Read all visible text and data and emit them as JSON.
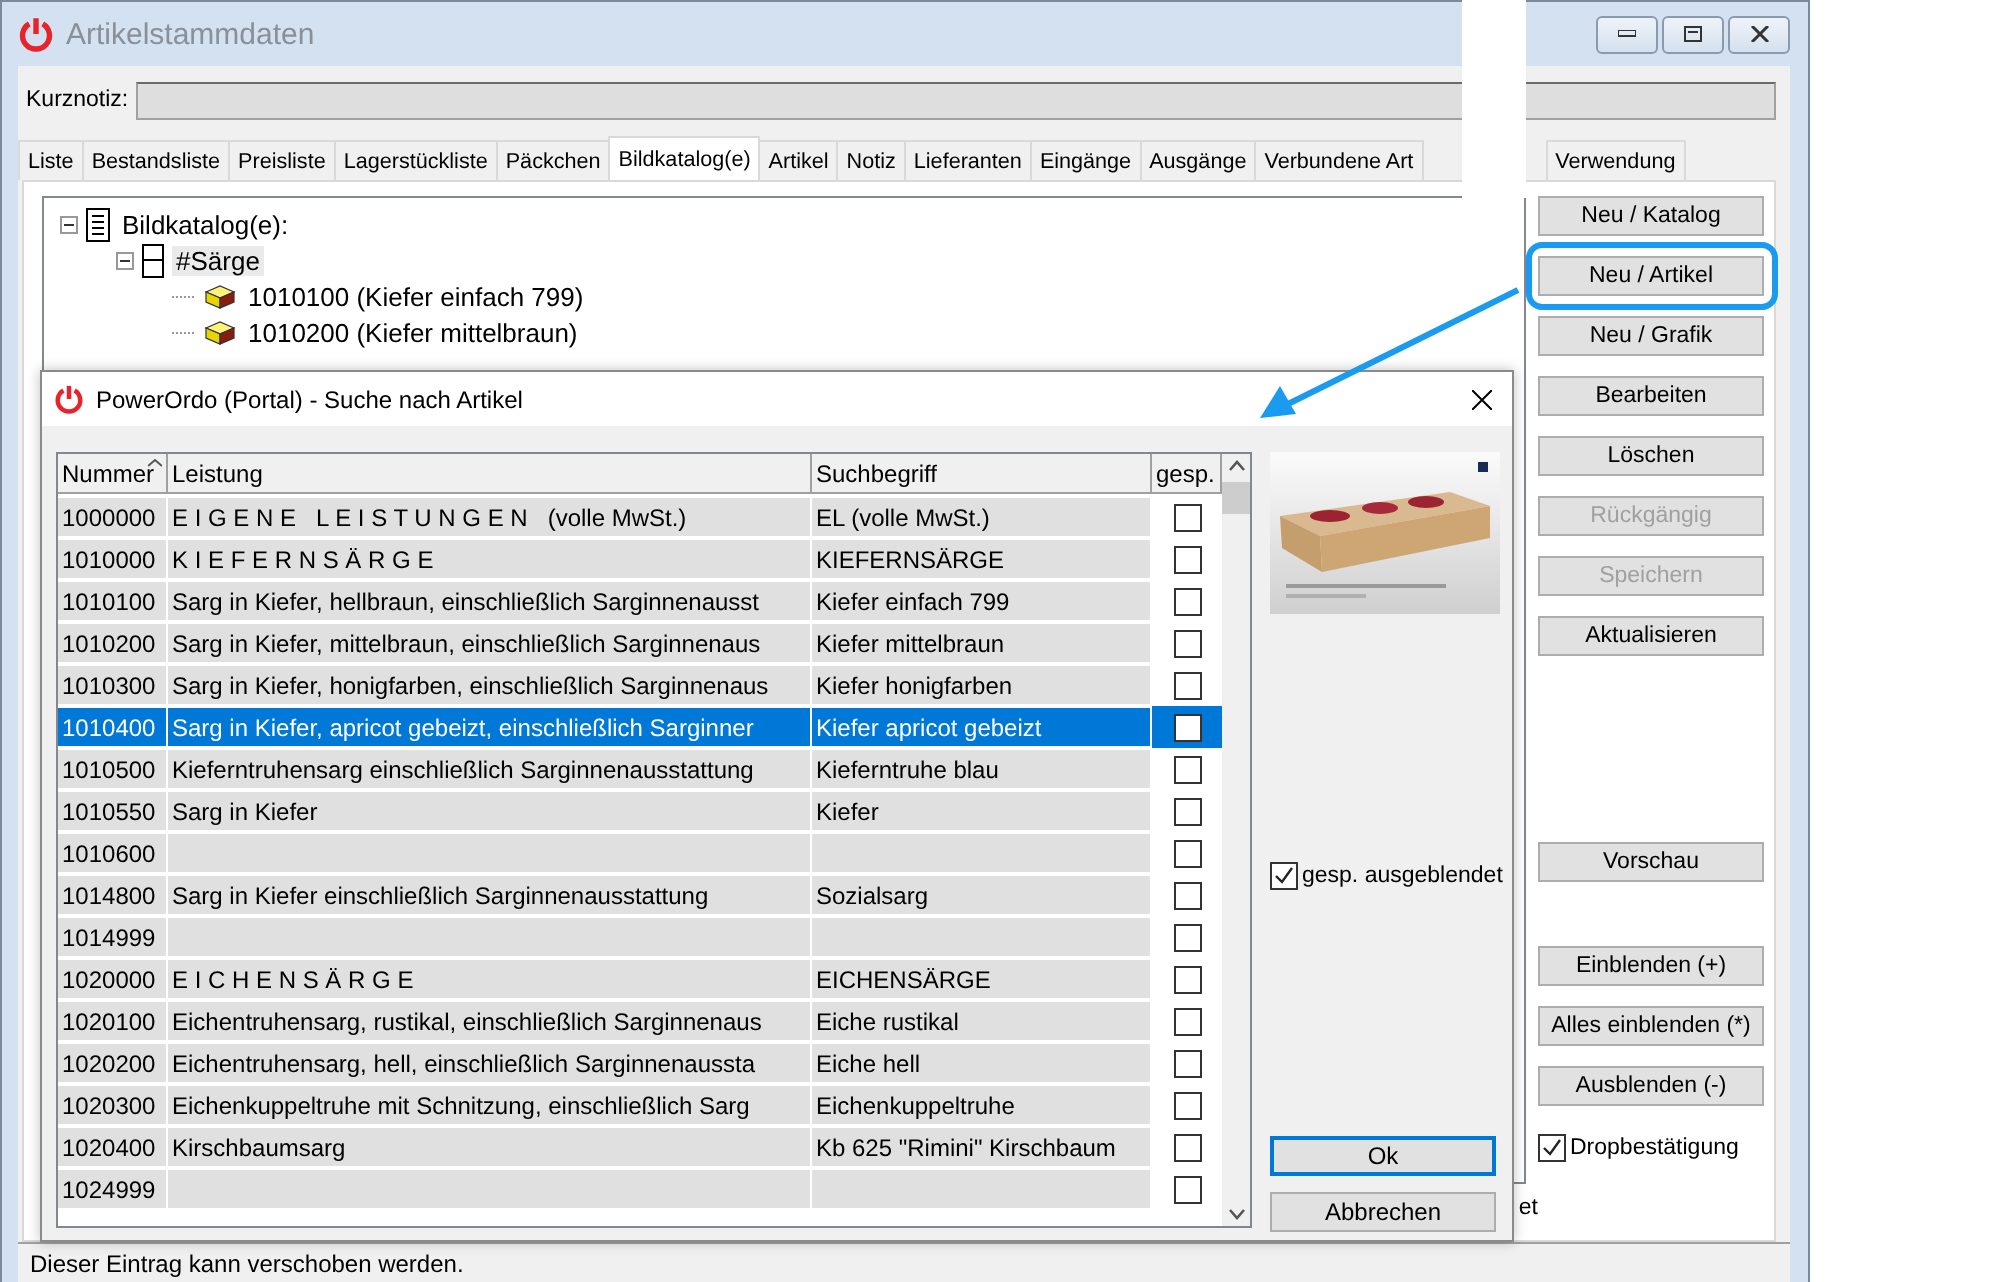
{
  "main_window": {
    "title": "Artikelstammdaten",
    "kurznotiz_label": "Kurznotiz:",
    "tabs": [
      {
        "label": "Liste",
        "selected": false
      },
      {
        "label": "Bestandsliste",
        "selected": false
      },
      {
        "label": "Preisliste",
        "selected": false
      },
      {
        "label": "Lagerstückliste",
        "selected": false
      },
      {
        "label": "Päckchen",
        "selected": false
      },
      {
        "label": "Bildkatalog(e)",
        "selected": true
      },
      {
        "label": "Artikel",
        "selected": false
      },
      {
        "label": "Notiz",
        "selected": false
      },
      {
        "label": "Lieferanten",
        "selected": false
      },
      {
        "label": "Eingänge",
        "selected": false
      },
      {
        "label": "Ausgänge",
        "selected": false
      },
      {
        "label": "Verbundene Art",
        "selected": false
      },
      {
        "label": "Verwendung",
        "selected": false
      }
    ],
    "tree": {
      "label": "Bildkatalog(e):",
      "expanded": true,
      "selected": false,
      "children": [
        {
          "label": "#Särge",
          "expanded": true,
          "selected": true,
          "children": [
            {
              "label": "1010100 (Kiefer einfach 799)",
              "selected": false
            },
            {
              "label": "1010200 (Kiefer mittelbraun)",
              "selected": false
            }
          ]
        }
      ]
    },
    "button_groups": [
      [
        {
          "label": "Neu / Katalog",
          "disabled": false,
          "highlighted": false
        },
        {
          "label": "Neu / Artikel",
          "disabled": false,
          "highlighted": true
        },
        {
          "label": "Neu / Grafik",
          "disabled": false,
          "highlighted": false
        },
        {
          "label": "Bearbeiten",
          "disabled": false,
          "highlighted": false
        },
        {
          "label": "Löschen",
          "disabled": false,
          "highlighted": false
        },
        {
          "label": "Rückgängig",
          "disabled": true,
          "highlighted": false
        },
        {
          "label": "Speichern",
          "disabled": true,
          "highlighted": false
        },
        {
          "label": "Aktualisieren",
          "disabled": false,
          "highlighted": false
        }
      ],
      [
        {
          "label": "Vorschau",
          "disabled": false,
          "highlighted": false
        }
      ],
      [
        {
          "label": "Einblenden (+)",
          "disabled": false,
          "highlighted": false
        },
        {
          "label": "Alles einblenden (*)",
          "disabled": false,
          "highlighted": false
        },
        {
          "label": "Ausblenden (-)",
          "disabled": false,
          "highlighted": false
        }
      ]
    ],
    "dropbestaetigung": {
      "label": "Dropbestätigung",
      "checked": true
    },
    "hidden_label": "et",
    "status": "Dieser Eintrag kann verschoben werden."
  },
  "dialog": {
    "title": "PowerOrdo (Portal) - Suche nach Artikel",
    "columns": [
      "Nummer",
      "Leistung",
      "Suchbegriff",
      "gesp."
    ],
    "rows": [
      {
        "nummer": "1000000",
        "leistung": "E I G E N E   L E I S T U N G E N   (volle MwSt.)",
        "suchbegriff": "EL (volle MwSt.)",
        "gesp": false,
        "selected": false
      },
      {
        "nummer": "1010000",
        "leistung": "K I E F E R N S Ä R G E",
        "suchbegriff": "KIEFERNSÄRGE",
        "gesp": false,
        "selected": false
      },
      {
        "nummer": "1010100",
        "leistung": "Sarg in Kiefer, hellbraun, einschließlich Sarginnenausst",
        "suchbegriff": "Kiefer einfach 799",
        "gesp": false,
        "selected": false
      },
      {
        "nummer": "1010200",
        "leistung": "Sarg in Kiefer, mittelbraun, einschließlich Sarginnenaus",
        "suchbegriff": "Kiefer mittelbraun",
        "gesp": false,
        "selected": false
      },
      {
        "nummer": "1010300",
        "leistung": "Sarg in Kiefer, honigfarben, einschließlich Sarginnenaus",
        "suchbegriff": "Kiefer honigfarben",
        "gesp": false,
        "selected": false
      },
      {
        "nummer": "1010400",
        "leistung": "Sarg in Kiefer, apricot gebeizt, einschließlich Sarginner",
        "suchbegriff": "Kiefer apricot gebeizt",
        "gesp": false,
        "selected": true
      },
      {
        "nummer": "1010500",
        "leistung": "Kieferntruhensarg einschließlich Sarginnenausstattung",
        "suchbegriff": "Kieferntruhe blau",
        "gesp": false,
        "selected": false
      },
      {
        "nummer": "1010550",
        "leistung": "Sarg in Kiefer",
        "suchbegriff": "Kiefer",
        "gesp": false,
        "selected": false
      },
      {
        "nummer": "1010600",
        "leistung": "",
        "suchbegriff": "",
        "gesp": false,
        "selected": false
      },
      {
        "nummer": "1014800",
        "leistung": "Sarg in Kiefer einschließlich Sarginnenausstattung",
        "suchbegriff": "Sozialsarg",
        "gesp": false,
        "selected": false
      },
      {
        "nummer": "1014999",
        "leistung": "",
        "suchbegriff": "",
        "gesp": false,
        "selected": false
      },
      {
        "nummer": "1020000",
        "leistung": "E I C H E N S Ä R G E",
        "suchbegriff": "EICHENSÄRGE",
        "gesp": false,
        "selected": false
      },
      {
        "nummer": "1020100",
        "leistung": "Eichentruhensarg, rustikal, einschließlich Sarginnenaus",
        "suchbegriff": "Eiche rustikal",
        "gesp": false,
        "selected": false
      },
      {
        "nummer": "1020200",
        "leistung": "Eichentruhensarg, hell, einschließlich Sarginnenaussta",
        "suchbegriff": "Eiche hell",
        "gesp": false,
        "selected": false
      },
      {
        "nummer": "1020300",
        "leistung": "Eichenkuppeltruhe mit Schnitzung, einschließlich Sarg",
        "suchbegriff": "Eichenkuppeltruhe",
        "gesp": false,
        "selected": false
      },
      {
        "nummer": "1020400",
        "leistung": "Kirschbaumsarg",
        "suchbegriff": "Kb 625 \"Rimini\" Kirschbaum",
        "gesp": false,
        "selected": false
      },
      {
        "nummer": "1024999",
        "leistung": "",
        "suchbegriff": "",
        "gesp": false,
        "selected": false
      }
    ],
    "hide_checkbox": {
      "label": "gesp. ausgeblendet",
      "checked": true
    },
    "buttons": [
      {
        "label": "Ok",
        "default": true
      },
      {
        "label": "Abbrechen",
        "default": false
      }
    ]
  }
}
